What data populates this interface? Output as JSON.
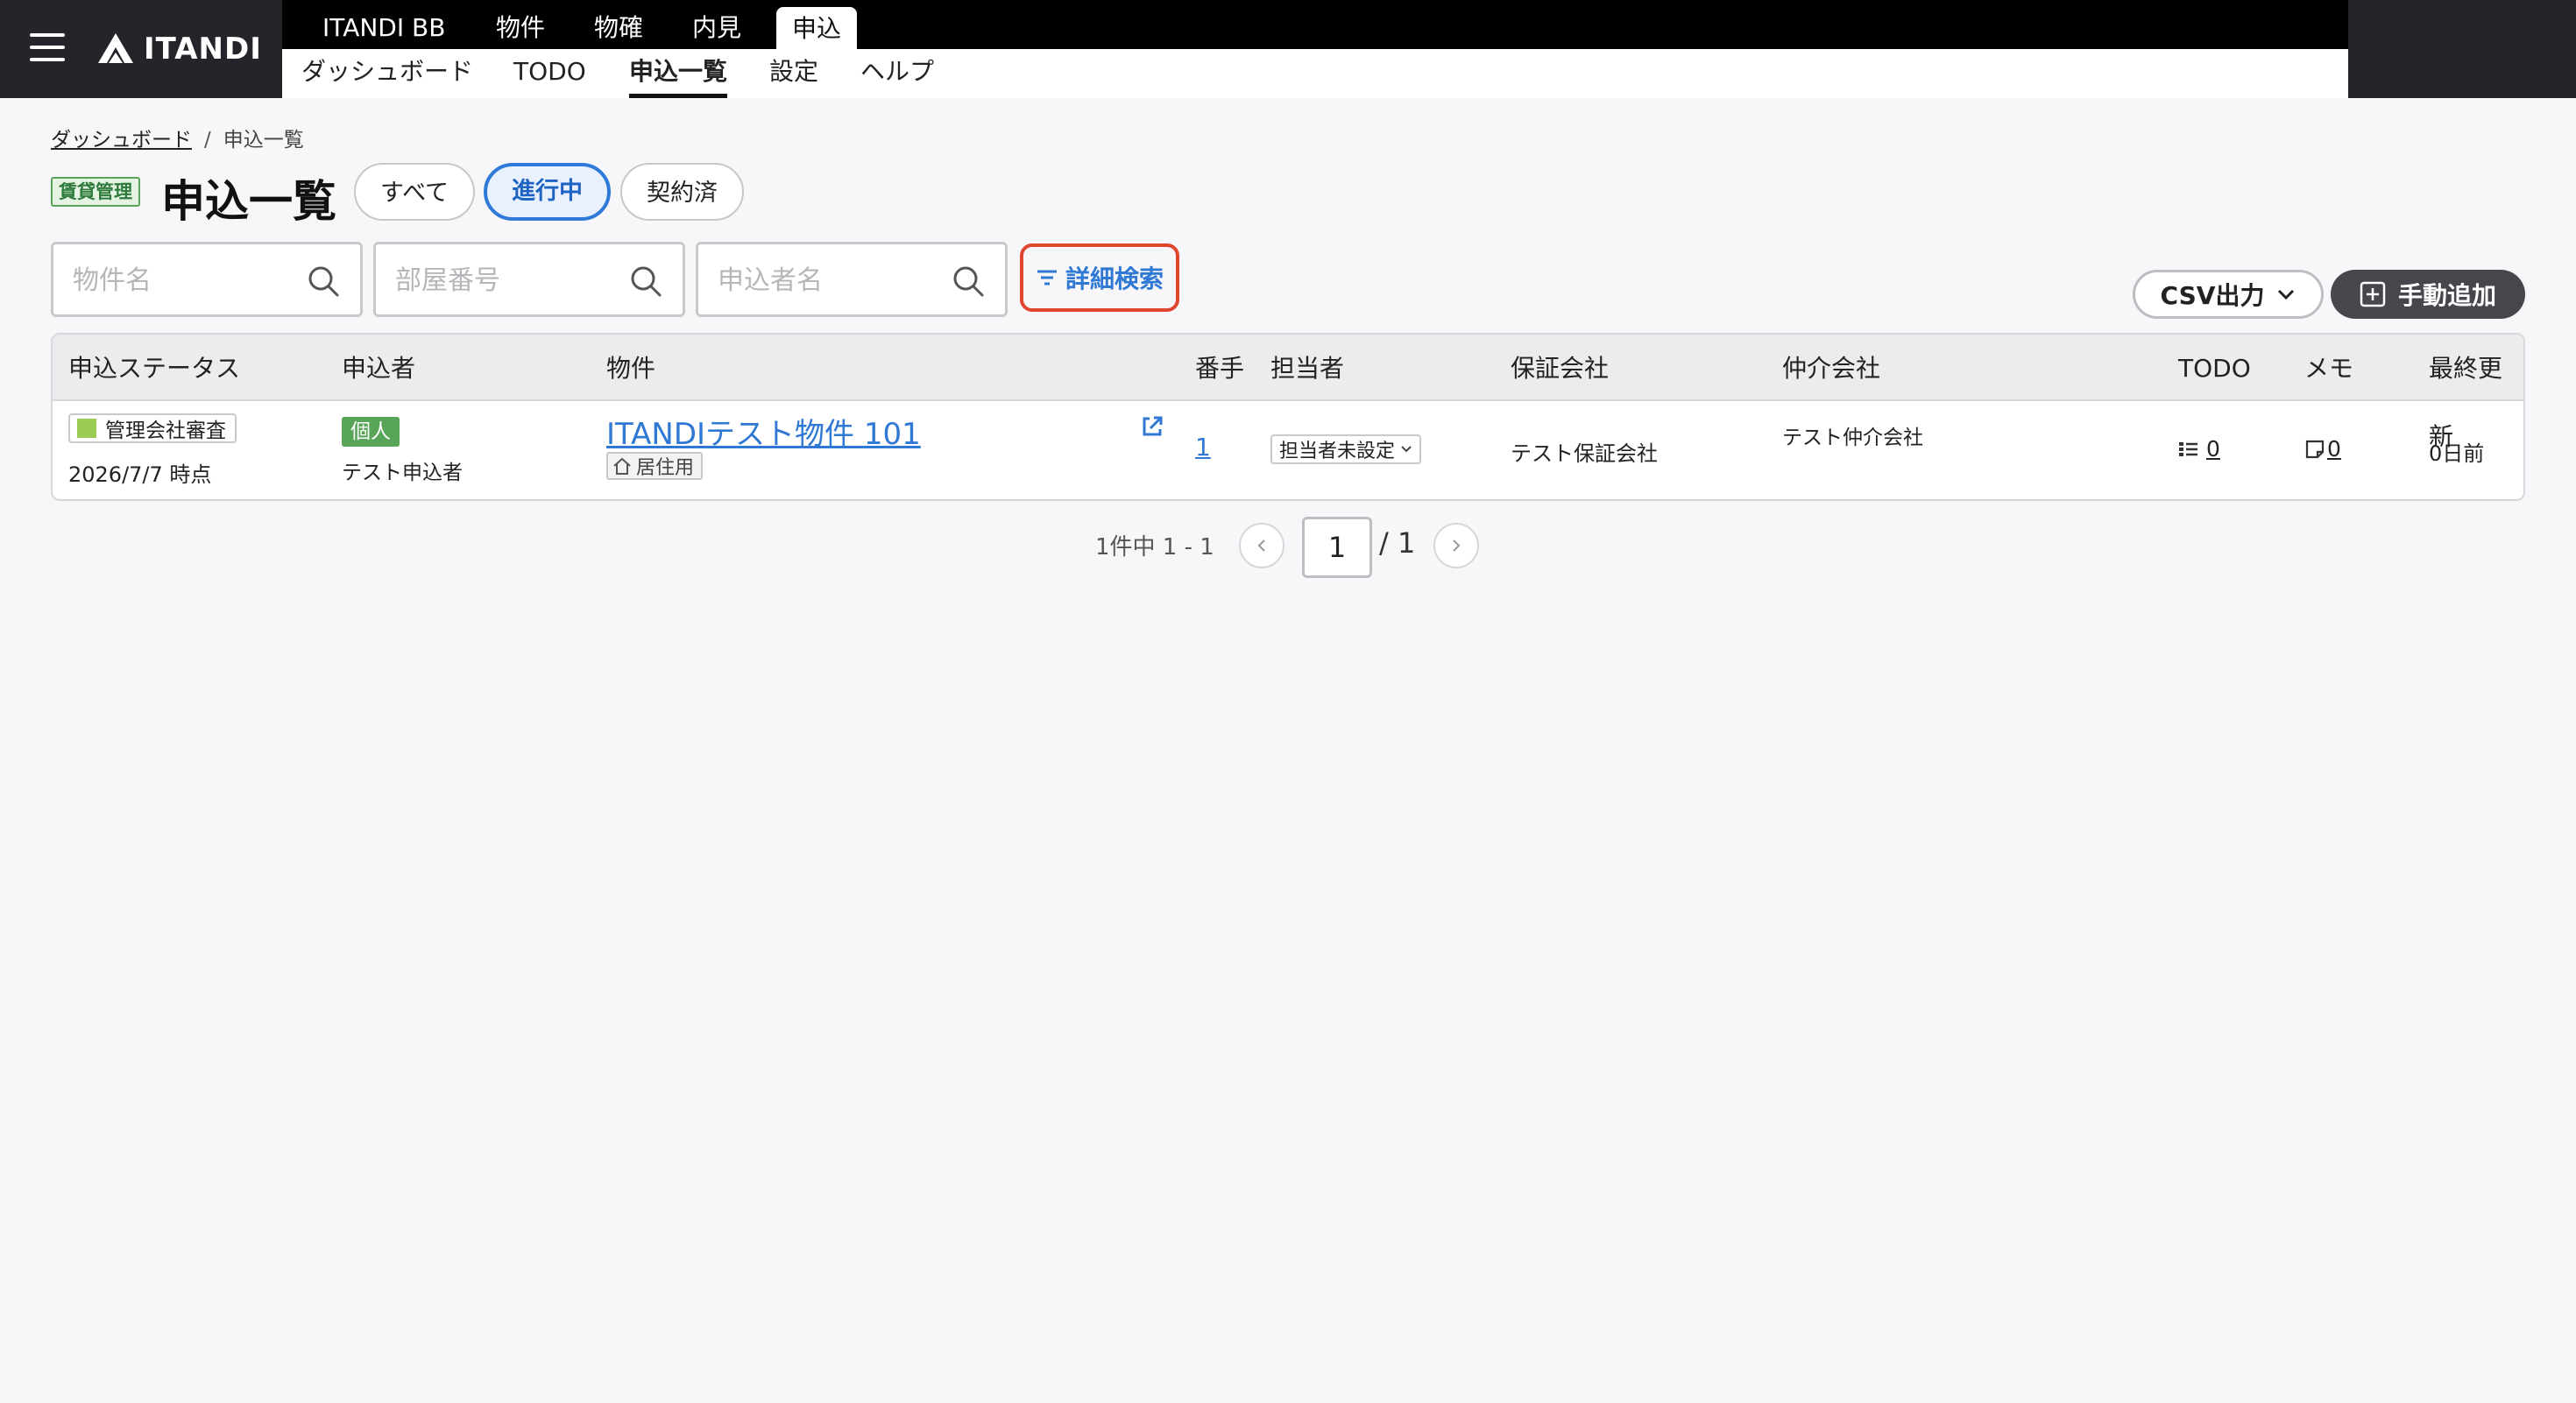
{
  "header": {
    "logo_text": "ITANDI",
    "top_tabs": [
      "ITANDI BB",
      "物件",
      "物確",
      "内見",
      "申込"
    ],
    "active_top_tab": "申込",
    "sub_tabs": [
      "ダッシュボード",
      "TODO",
      "申込一覧",
      "設定",
      "ヘルプ"
    ],
    "active_sub_tab": "申込一覧"
  },
  "breadcrumb": {
    "home": "ダッシュボード",
    "separator": "/",
    "current": "申込一覧"
  },
  "page": {
    "category_tag": "賃貸管理",
    "title": "申込一覧",
    "filters": [
      "すべて",
      "進行中",
      "契約済"
    ],
    "active_filter": "進行中"
  },
  "search": {
    "property_placeholder": "物件名",
    "room_placeholder": "部屋番号",
    "applicant_placeholder": "申込者名",
    "advanced_label": "詳細検索"
  },
  "actions": {
    "csv_label": "CSV出力",
    "add_label": "手動追加"
  },
  "table": {
    "columns": [
      "申込ステータス",
      "申込者",
      "物件",
      "番手",
      "担当者",
      "保証会社",
      "仲介会社",
      "TODO",
      "メモ",
      "最終更新"
    ],
    "rows": [
      {
        "status": "管理会社審査",
        "status_time": "2026/7/7 時点",
        "applicant_type": "個人",
        "applicant_name": "テスト申込者",
        "property": "ITANDIテスト物件 101",
        "property_use": "居住用",
        "bante": "1",
        "tanto": "担当者未設定",
        "guarantor": "テスト保証会社",
        "broker": "テスト仲介会社",
        "todo_count": "0",
        "memo_count": "0",
        "updated": "0日前"
      }
    ]
  },
  "pagination": {
    "count_text": "1件中 1 - 1",
    "current_page": "1",
    "total_text": "/ 1"
  },
  "colors": {
    "accent_blue": "#2f78d4",
    "highlight_red": "#e0452f",
    "status_green": "#9acb53",
    "kojin_green": "#58a458",
    "topbar": "#26232b"
  }
}
